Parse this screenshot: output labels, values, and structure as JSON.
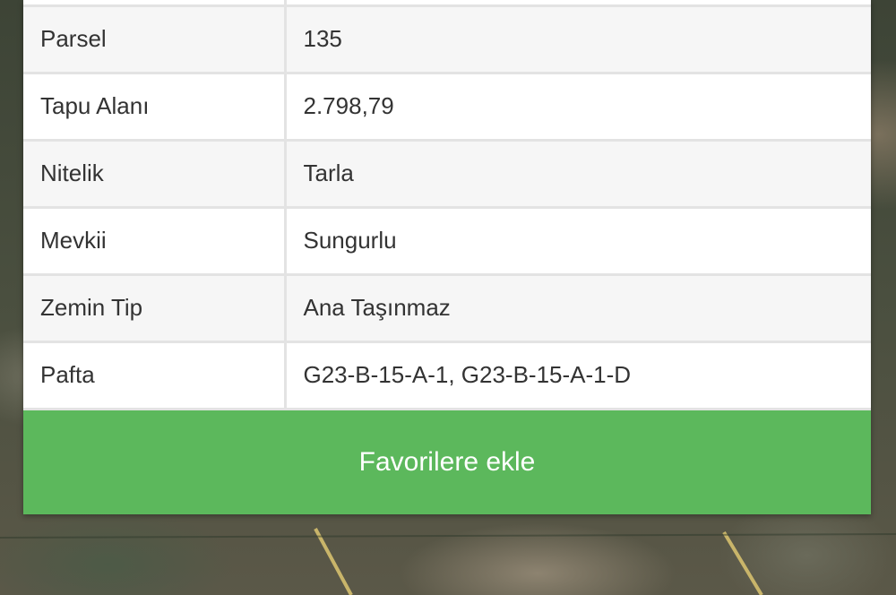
{
  "details": {
    "rows": [
      {
        "label": "Parsel",
        "value": "135"
      },
      {
        "label": "Tapu Alanı",
        "value": "2.798,79"
      },
      {
        "label": "Nitelik",
        "value": "Tarla"
      },
      {
        "label": "Mevkii",
        "value": "Sungurlu"
      },
      {
        "label": "Zemin Tip",
        "value": "Ana Taşınmaz"
      },
      {
        "label": "Pafta",
        "value": "G23-B-15-A-1, G23-B-15-A-1-D"
      }
    ]
  },
  "actions": {
    "favorite_label": "Favorilere ekle"
  },
  "colors": {
    "button_green": "#5cb85c",
    "row_alt": "#f6f6f6",
    "border": "#e3e3e3"
  }
}
